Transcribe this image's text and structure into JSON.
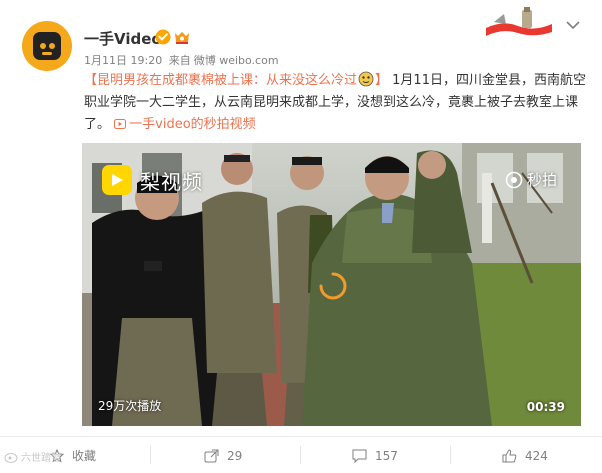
{
  "post": {
    "username": "一手Video",
    "meta": {
      "date": "1月11日 19:20",
      "source_prefix": "来自",
      "source": "微博 weibo.com"
    },
    "content": {
      "topic": "【昆明男孩在成都裹棉被上课：从来没这么冷过",
      "topic_end": "】",
      "body": " 1月11日，四川金堂县，西南航空职业学院一大二学生，从云南昆明来成都上学，没想到这么冷，竟裹上被子去教室上课了。",
      "video_link": "一手video的秒拍视频"
    },
    "video": {
      "brand": "梨视频",
      "miaopai": "秒拍",
      "plays": "29万次播放",
      "duration": "00:39"
    }
  },
  "actions": {
    "favorite": "收藏",
    "forward": "29",
    "comment": "157",
    "like": "424"
  },
  "watermark": "六世踏雪",
  "colors": {
    "accent": "#eb7350",
    "verified": "#ffa500",
    "text": "#333333",
    "muted": "#808080"
  },
  "icons": [
    "verified-icon",
    "vip-icon",
    "smiley-icon",
    "play-link-icon",
    "caret-down-icon",
    "favorite-icon",
    "forward-icon",
    "comment-icon",
    "like-icon",
    "spinner-icon",
    "miaopai-icon",
    "pear-logo-icon"
  ]
}
